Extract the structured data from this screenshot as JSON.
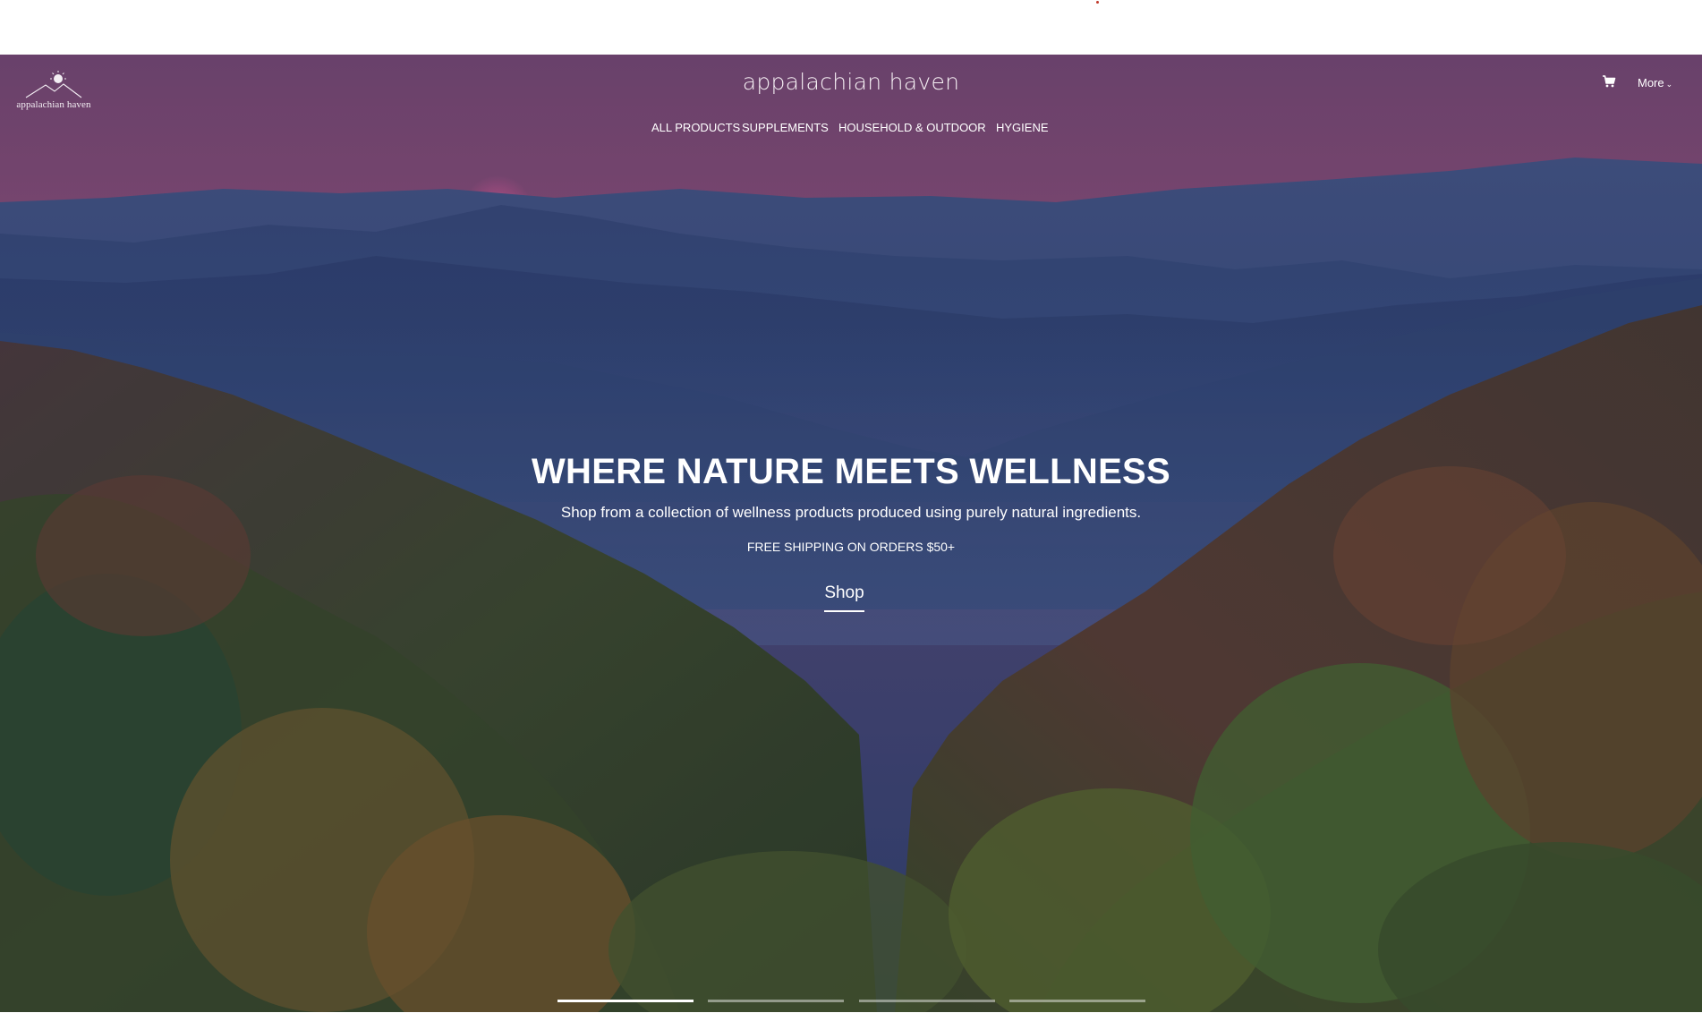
{
  "header": {
    "logo_text": "appalachian haven",
    "brand_title": "appalachian haven",
    "more_label": "More",
    "cart_icon": "cart-icon"
  },
  "nav": {
    "items": [
      {
        "label": "ALL PRODUCTS"
      },
      {
        "label": "SUPPLEMENTS"
      },
      {
        "label": "HOUSEHOLD & OUTDOOR"
      },
      {
        "label": "HYGIENE"
      }
    ]
  },
  "hero": {
    "headline": "WHERE NATURE MEETS WELLNESS",
    "subheadline": "Shop from a collection of wellness products produced using purely natural ingredients.",
    "shipping_note": "FREE SHIPPING ON ORDERS $50+",
    "cta_label": "Shop",
    "slides_total": 4,
    "active_slide": 1
  },
  "colors": {
    "sky_top": "#7b4a78",
    "sky_bottom": "#8a4f7a",
    "mountains": "#3c4f7e",
    "text": "#ffffff"
  }
}
